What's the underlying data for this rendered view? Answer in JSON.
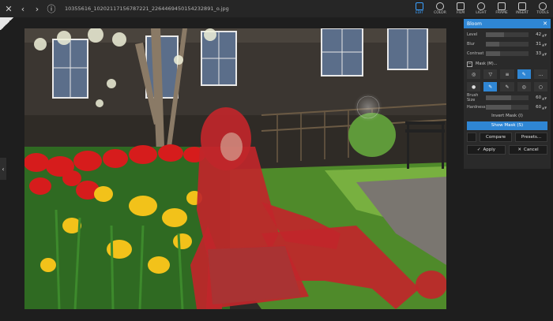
{
  "toolbar": {
    "filename": "10355616_10202117156787221_2264469450154232891_o.jpg",
    "tools": [
      {
        "label": "EDIT",
        "icon": "sliders-icon",
        "active": true
      },
      {
        "label": "COLOR",
        "icon": "color-circle-icon"
      },
      {
        "label": "FILM",
        "icon": "film-icon"
      },
      {
        "label": "LIGHT",
        "icon": "sun-icon"
      },
      {
        "label": "FRAME",
        "icon": "frame-icon"
      },
      {
        "label": "INSERT",
        "icon": "insert-icon"
      },
      {
        "label": "TOOLS",
        "icon": "tools-icon"
      }
    ]
  },
  "panel": {
    "title": "Bloom",
    "close": "✕",
    "sliders": [
      {
        "label": "Level",
        "value": "42",
        "fraction": 0.42
      },
      {
        "label": "Blur",
        "value": "31",
        "fraction": 0.31
      },
      {
        "label": "Contrast",
        "value": "33",
        "fraction": 0.33
      }
    ],
    "mask_label": "Mask (M)...",
    "mask_toggle": "−",
    "mask_tools_row1": [
      "◎",
      "▽",
      "≡",
      "✎",
      "…"
    ],
    "mask_tools_row2": [
      "●",
      "✎",
      "✎",
      "◎",
      "○"
    ],
    "brush_sliders": [
      {
        "label": "Brush Size",
        "value": "60",
        "fraction": 0.6
      },
      {
        "label": "Hardness",
        "value": "60",
        "fraction": 0.6
      }
    ],
    "invert_mask": "Invert Mask (I)",
    "show_mask": "Show Mask (S)",
    "compare": "Compare",
    "presets": "Presets...",
    "apply": "Apply",
    "cancel": "Cancel"
  }
}
